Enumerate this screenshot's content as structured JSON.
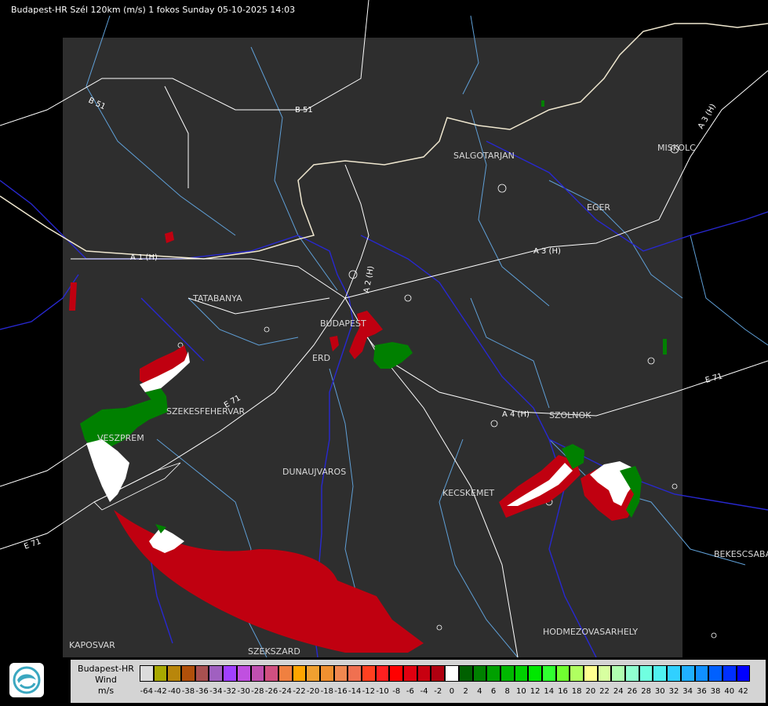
{
  "title": "Budapest-HR Szél 120km (m/s) 1 fokos Sunday 05-10-2025 14:03",
  "colors": {
    "background": "#000000",
    "radar_area": "#2e2e2e",
    "river": "#2020c8",
    "border": "#f0e8d0",
    "road": "#ffffff",
    "county_line": "#5f9fd6",
    "approaching": "#c00010",
    "receding": "#008000"
  },
  "cities": [
    {
      "name": "SALGOTARJAN"
    },
    {
      "name": "MISKOLC"
    },
    {
      "name": "EGER"
    },
    {
      "name": "TATABANYA"
    },
    {
      "name": "BUDAPEST"
    },
    {
      "name": "ERD"
    },
    {
      "name": "SZEKESFEHERVAR"
    },
    {
      "name": "VESZPREM"
    },
    {
      "name": "DUNAUJVAROS"
    },
    {
      "name": "KECSKEMET"
    },
    {
      "name": "SZOLNOK"
    },
    {
      "name": "BEKESCSABA"
    },
    {
      "name": "HODMEZOVASARHELY"
    },
    {
      "name": "KAPOSVAR"
    },
    {
      "name": "SZEKSZARD"
    }
  ],
  "roads": [
    {
      "label": "B 51"
    },
    {
      "label": "B 51"
    },
    {
      "label": "A 3 (H)"
    },
    {
      "label": "A 3 (H)"
    },
    {
      "label": "A 1 (H)"
    },
    {
      "label": "A 2 (H)"
    },
    {
      "label": "E 71"
    },
    {
      "label": "A 4 (H)"
    },
    {
      "label": "E 71"
    },
    {
      "label": "E 71"
    }
  ],
  "legend": {
    "name_lines": [
      "Budapest-HR",
      "Wind",
      "m/s"
    ],
    "bins": [
      {
        "label": "-64",
        "color": "#dcdcdc"
      },
      {
        "label": "-42",
        "color": "#a8a800"
      },
      {
        "label": "-40",
        "color": "#b8860b"
      },
      {
        "label": "-38",
        "color": "#b0500a"
      },
      {
        "label": "-36",
        "color": "#a85050"
      },
      {
        "label": "-34",
        "color": "#a060c0"
      },
      {
        "label": "-32",
        "color": "#a040ff"
      },
      {
        "label": "-30",
        "color": "#c050e0"
      },
      {
        "label": "-28",
        "color": "#c050b0"
      },
      {
        "label": "-26",
        "color": "#d05080"
      },
      {
        "label": "-24",
        "color": "#f08040"
      },
      {
        "label": "-22",
        "color": "#ffa500"
      },
      {
        "label": "-20",
        "color": "#f0a030"
      },
      {
        "label": "-18",
        "color": "#f09030"
      },
      {
        "label": "-16",
        "color": "#f08850"
      },
      {
        "label": "-14",
        "color": "#f07050"
      },
      {
        "label": "-12",
        "color": "#ff4020"
      },
      {
        "label": "-10",
        "color": "#ff2020"
      },
      {
        "label": "-8",
        "color": "#ff0000"
      },
      {
        "label": "-6",
        "color": "#e00010"
      },
      {
        "label": "-4",
        "color": "#c80010"
      },
      {
        "label": "-2",
        "color": "#b00010"
      },
      {
        "label": "0",
        "color": "#ffffff"
      },
      {
        "label": "2",
        "color": "#006000"
      },
      {
        "label": "4",
        "color": "#008000"
      },
      {
        "label": "6",
        "color": "#00a000"
      },
      {
        "label": "8",
        "color": "#00b800"
      },
      {
        "label": "10",
        "color": "#00d000"
      },
      {
        "label": "12",
        "color": "#00e800"
      },
      {
        "label": "14",
        "color": "#30ff30"
      },
      {
        "label": "16",
        "color": "#70ff30"
      },
      {
        "label": "18",
        "color": "#b0ff60"
      },
      {
        "label": "20",
        "color": "#ffff90"
      },
      {
        "label": "22",
        "color": "#d8ffa0"
      },
      {
        "label": "24",
        "color": "#b0ffb0"
      },
      {
        "label": "26",
        "color": "#90ffd0"
      },
      {
        "label": "28",
        "color": "#70ffe0"
      },
      {
        "label": "30",
        "color": "#50f0f0"
      },
      {
        "label": "32",
        "color": "#30d0ff"
      },
      {
        "label": "34",
        "color": "#20b0ff"
      },
      {
        "label": "36",
        "color": "#1090ff"
      },
      {
        "label": "38",
        "color": "#0060ff"
      },
      {
        "label": "40",
        "color": "#0030ff"
      },
      {
        "label": "42",
        "color": "#0000ff"
      }
    ]
  }
}
